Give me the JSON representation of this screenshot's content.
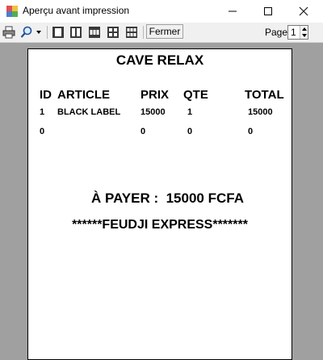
{
  "window": {
    "title": "Aperçu avant impression",
    "minimize_icon": "minimize-icon",
    "maximize_icon": "maximize-icon",
    "close_icon": "close-icon"
  },
  "toolbar": {
    "print_icon": "printer-icon",
    "zoom_icon": "zoom-magnifier-icon",
    "layouts": [
      "one-page-icon",
      "two-pages-icon",
      "three-pages-icon",
      "four-pages-icon",
      "six-pages-icon"
    ],
    "close_label": "Fermer",
    "page_label": "Page",
    "page_value": "1"
  },
  "document": {
    "title": "CAVE RELAX",
    "columns": [
      "ID",
      "ARTICLE",
      "PRIX",
      "QTE",
      "TOTAL"
    ],
    "rows": [
      [
        "1",
        "BLACK LABEL",
        "15000",
        "1",
        "15000"
      ],
      [
        "0",
        "",
        "0",
        "0",
        "0"
      ]
    ],
    "payment_label": "À PAYER :",
    "payment_value": "15000 FCFA",
    "footer": "******FEUDJI EXPRESS*******"
  }
}
